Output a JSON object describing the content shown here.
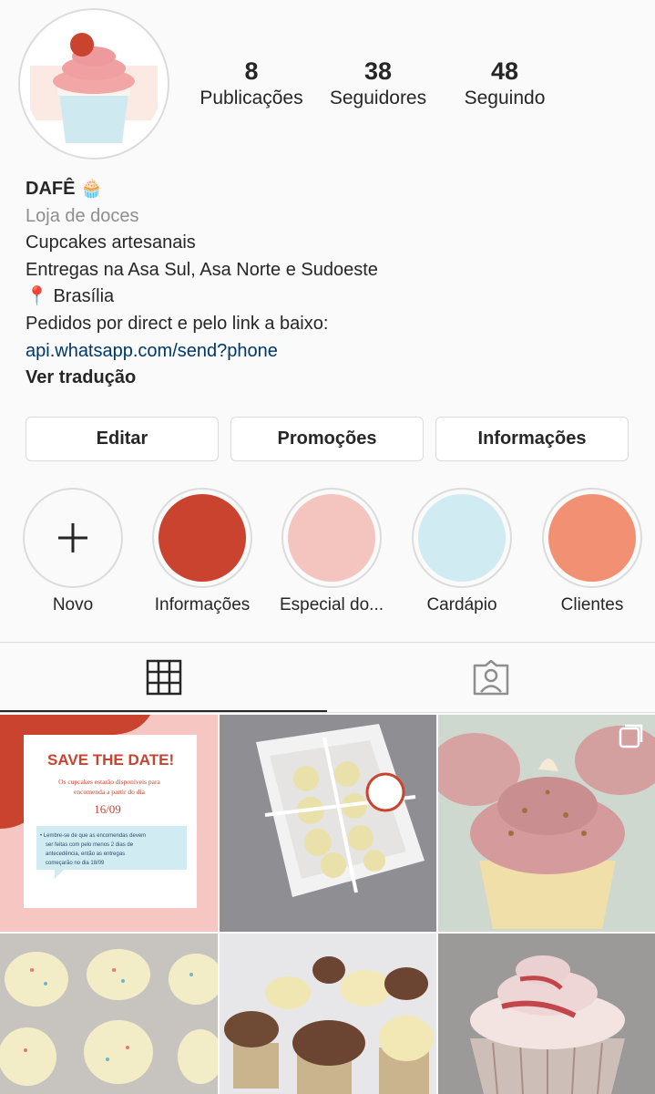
{
  "profile": {
    "stats": [
      {
        "count": "8",
        "label": "Publicações"
      },
      {
        "count": "38",
        "label": "Seguidores"
      },
      {
        "count": "48",
        "label": "Seguindo"
      }
    ],
    "name": "DAFÊ 🧁",
    "category": "Loja de doces",
    "bio_lines": [
      "Cupcakes artesanais",
      "Entregas na Asa Sul, Asa Norte e Sudoeste",
      "📍 Brasília",
      "Pedidos por direct e pelo link a baixo:"
    ],
    "link": "api.whatsapp.com/send?phone",
    "translate": "Ver tradução"
  },
  "buttons": {
    "edit": "Editar",
    "promotions": "Promoções",
    "info": "Informações"
  },
  "highlights": [
    {
      "label": "Novo",
      "icon": "plus-icon"
    },
    {
      "label": "Informações",
      "color": "#c9432f"
    },
    {
      "label": "Especial do...",
      "color": "#f4c4bf"
    },
    {
      "label": "Cardápio",
      "color": "#d0ecf2"
    },
    {
      "label": "Clientes",
      "color": "#f19072"
    }
  ],
  "tabs": {
    "grid_icon": "grid-icon",
    "tagged_icon": "tagged-person-icon"
  },
  "posts": {
    "save_the_date": {
      "title": "SAVE THE DATE!",
      "line1": "Os cupcakes estarão disponíveis para",
      "line2": "encomenda a partir do dia",
      "date": "16/09",
      "note1": "• Lembre-se de que as encomendas devem",
      "note2": "ser feitas com pelo menos 2 dias de",
      "note3": "antecedência, então as entregas",
      "note4": "começarão no dia 18/09"
    }
  }
}
